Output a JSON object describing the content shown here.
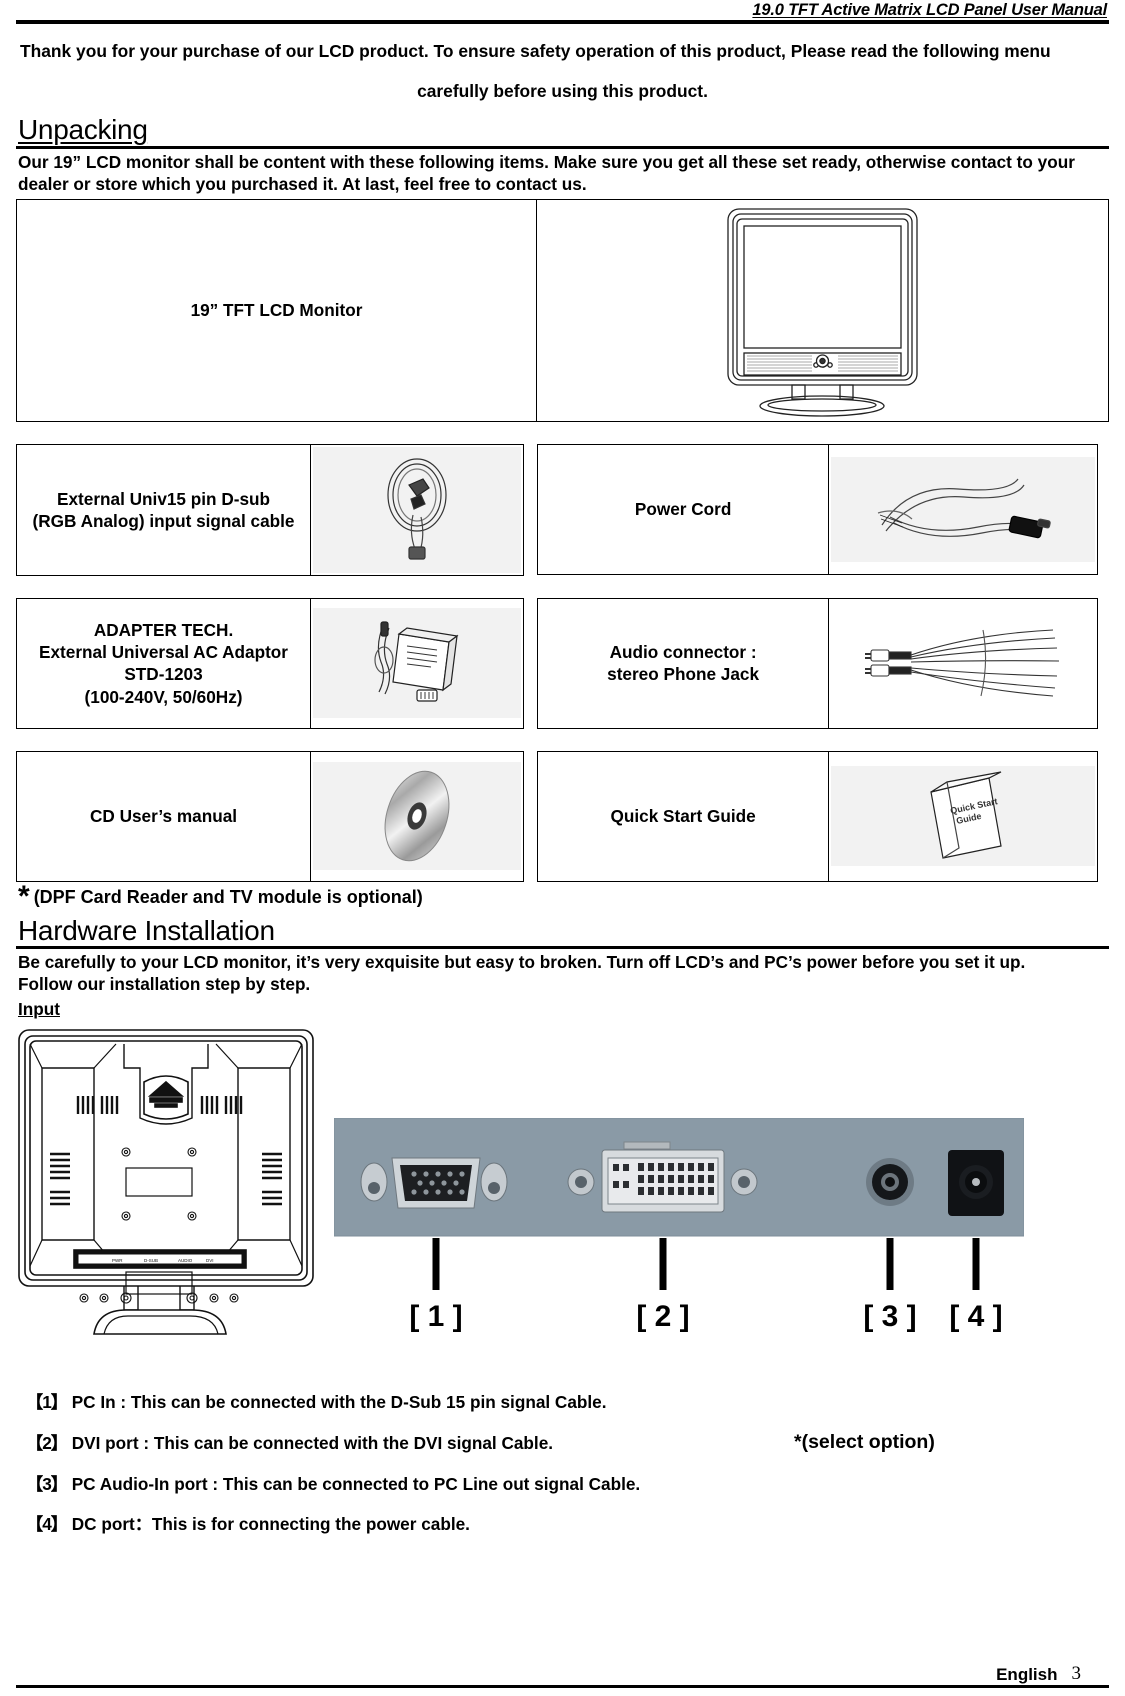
{
  "header": {
    "title": "19.0 TFT Active Matrix LCD Panel User Manual"
  },
  "intro": {
    "line1": "Thank you for your purchase of our LCD product. To ensure safety operation of this product, Please read the following menu",
    "line2": "carefully before using this product."
  },
  "unpacking": {
    "heading": "Unpacking",
    "body": "Our 19” LCD monitor shall be content with these following items. Make sure you get all these set ready, otherwise contact to your dealer or store which you purchased it. At last, feel free to contact us.",
    "main_item": {
      "label": "19” TFT LCD Monitor",
      "image": "lcd-monitor-front-illustration"
    },
    "items": [
      {
        "label": "External Univ15 pin D-sub\n(RGB Analog) input signal cable",
        "image": "vga-cable-photo"
      },
      {
        "label": "Power Cord",
        "image": "power-cord-photo"
      },
      {
        "label": "ADAPTER TECH.\nExternal Universal AC Adaptor\nSTD-1203\n(100-240V, 50/60Hz)",
        "image": "ac-adaptor-photo"
      },
      {
        "label": "Audio connector :\nstereo Phone Jack",
        "image": "audio-cable-photo"
      },
      {
        "label": "CD User’s manual",
        "image": "cd-disc-photo"
      },
      {
        "label": "Quick Start Guide",
        "image": "quick-start-guide-photo",
        "image_caption": "Quick Start Guide"
      }
    ],
    "optional_note_star": "*",
    "optional_note": "(DPF Card Reader and TV module is optional)"
  },
  "hardware": {
    "heading": "Hardware Installation",
    "body_line1": "Be carefully to your LCD monitor, it’s very exquisite but easy to broken. Turn off LCD’s and PC’s power before you set it up.",
    "body_line2": "Follow our installation step by step.",
    "sub_heading": "Input",
    "rear_image": "lcd-monitor-rear-illustration",
    "port_photo": "rear-port-panel-photo",
    "callouts": [
      "[ 1 ]",
      "[ 2 ]",
      "[ 3 ]",
      "[ 4 ]"
    ],
    "ports": [
      {
        "num": "【1】",
        "text": "PC In : This can be connected with the D-Sub 15 pin signal Cable."
      },
      {
        "num": "【2】",
        "text": "DVI port : This can be connected with the DVI signal Cable.",
        "note": "*(select option)"
      },
      {
        "num": "【3】",
        "text": "PC Audio-In port : This can be connected to PC Line out signal Cable."
      },
      {
        "num": "【4】",
        "text": "DC port：This is for connecting the power cable."
      }
    ]
  },
  "footer": {
    "language": "English",
    "page": "3"
  }
}
